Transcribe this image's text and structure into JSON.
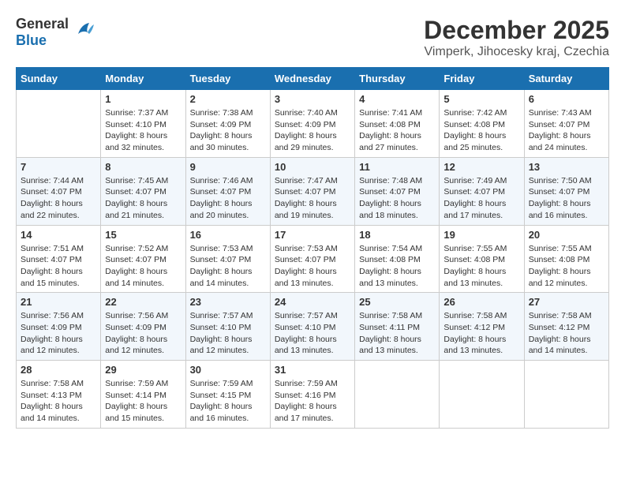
{
  "logo": {
    "general": "General",
    "blue": "Blue"
  },
  "title": "December 2025",
  "subtitle": "Vimperk, Jihocesky kraj, Czechia",
  "days_header": [
    "Sunday",
    "Monday",
    "Tuesday",
    "Wednesday",
    "Thursday",
    "Friday",
    "Saturday"
  ],
  "weeks": [
    [
      {
        "day": "",
        "sunrise": "",
        "sunset": "",
        "daylight": ""
      },
      {
        "day": "1",
        "sunrise": "Sunrise: 7:37 AM",
        "sunset": "Sunset: 4:10 PM",
        "daylight": "Daylight: 8 hours and 32 minutes."
      },
      {
        "day": "2",
        "sunrise": "Sunrise: 7:38 AM",
        "sunset": "Sunset: 4:09 PM",
        "daylight": "Daylight: 8 hours and 30 minutes."
      },
      {
        "day": "3",
        "sunrise": "Sunrise: 7:40 AM",
        "sunset": "Sunset: 4:09 PM",
        "daylight": "Daylight: 8 hours and 29 minutes."
      },
      {
        "day": "4",
        "sunrise": "Sunrise: 7:41 AM",
        "sunset": "Sunset: 4:08 PM",
        "daylight": "Daylight: 8 hours and 27 minutes."
      },
      {
        "day": "5",
        "sunrise": "Sunrise: 7:42 AM",
        "sunset": "Sunset: 4:08 PM",
        "daylight": "Daylight: 8 hours and 25 minutes."
      },
      {
        "day": "6",
        "sunrise": "Sunrise: 7:43 AM",
        "sunset": "Sunset: 4:07 PM",
        "daylight": "Daylight: 8 hours and 24 minutes."
      }
    ],
    [
      {
        "day": "7",
        "sunrise": "Sunrise: 7:44 AM",
        "sunset": "Sunset: 4:07 PM",
        "daylight": "Daylight: 8 hours and 22 minutes."
      },
      {
        "day": "8",
        "sunrise": "Sunrise: 7:45 AM",
        "sunset": "Sunset: 4:07 PM",
        "daylight": "Daylight: 8 hours and 21 minutes."
      },
      {
        "day": "9",
        "sunrise": "Sunrise: 7:46 AM",
        "sunset": "Sunset: 4:07 PM",
        "daylight": "Daylight: 8 hours and 20 minutes."
      },
      {
        "day": "10",
        "sunrise": "Sunrise: 7:47 AM",
        "sunset": "Sunset: 4:07 PM",
        "daylight": "Daylight: 8 hours and 19 minutes."
      },
      {
        "day": "11",
        "sunrise": "Sunrise: 7:48 AM",
        "sunset": "Sunset: 4:07 PM",
        "daylight": "Daylight: 8 hours and 18 minutes."
      },
      {
        "day": "12",
        "sunrise": "Sunrise: 7:49 AM",
        "sunset": "Sunset: 4:07 PM",
        "daylight": "Daylight: 8 hours and 17 minutes."
      },
      {
        "day": "13",
        "sunrise": "Sunrise: 7:50 AM",
        "sunset": "Sunset: 4:07 PM",
        "daylight": "Daylight: 8 hours and 16 minutes."
      }
    ],
    [
      {
        "day": "14",
        "sunrise": "Sunrise: 7:51 AM",
        "sunset": "Sunset: 4:07 PM",
        "daylight": "Daylight: 8 hours and 15 minutes."
      },
      {
        "day": "15",
        "sunrise": "Sunrise: 7:52 AM",
        "sunset": "Sunset: 4:07 PM",
        "daylight": "Daylight: 8 hours and 14 minutes."
      },
      {
        "day": "16",
        "sunrise": "Sunrise: 7:53 AM",
        "sunset": "Sunset: 4:07 PM",
        "daylight": "Daylight: 8 hours and 14 minutes."
      },
      {
        "day": "17",
        "sunrise": "Sunrise: 7:53 AM",
        "sunset": "Sunset: 4:07 PM",
        "daylight": "Daylight: 8 hours and 13 minutes."
      },
      {
        "day": "18",
        "sunrise": "Sunrise: 7:54 AM",
        "sunset": "Sunset: 4:08 PM",
        "daylight": "Daylight: 8 hours and 13 minutes."
      },
      {
        "day": "19",
        "sunrise": "Sunrise: 7:55 AM",
        "sunset": "Sunset: 4:08 PM",
        "daylight": "Daylight: 8 hours and 13 minutes."
      },
      {
        "day": "20",
        "sunrise": "Sunrise: 7:55 AM",
        "sunset": "Sunset: 4:08 PM",
        "daylight": "Daylight: 8 hours and 12 minutes."
      }
    ],
    [
      {
        "day": "21",
        "sunrise": "Sunrise: 7:56 AM",
        "sunset": "Sunset: 4:09 PM",
        "daylight": "Daylight: 8 hours and 12 minutes."
      },
      {
        "day": "22",
        "sunrise": "Sunrise: 7:56 AM",
        "sunset": "Sunset: 4:09 PM",
        "daylight": "Daylight: 8 hours and 12 minutes."
      },
      {
        "day": "23",
        "sunrise": "Sunrise: 7:57 AM",
        "sunset": "Sunset: 4:10 PM",
        "daylight": "Daylight: 8 hours and 12 minutes."
      },
      {
        "day": "24",
        "sunrise": "Sunrise: 7:57 AM",
        "sunset": "Sunset: 4:10 PM",
        "daylight": "Daylight: 8 hours and 13 minutes."
      },
      {
        "day": "25",
        "sunrise": "Sunrise: 7:58 AM",
        "sunset": "Sunset: 4:11 PM",
        "daylight": "Daylight: 8 hours and 13 minutes."
      },
      {
        "day": "26",
        "sunrise": "Sunrise: 7:58 AM",
        "sunset": "Sunset: 4:12 PM",
        "daylight": "Daylight: 8 hours and 13 minutes."
      },
      {
        "day": "27",
        "sunrise": "Sunrise: 7:58 AM",
        "sunset": "Sunset: 4:12 PM",
        "daylight": "Daylight: 8 hours and 14 minutes."
      }
    ],
    [
      {
        "day": "28",
        "sunrise": "Sunrise: 7:58 AM",
        "sunset": "Sunset: 4:13 PM",
        "daylight": "Daylight: 8 hours and 14 minutes."
      },
      {
        "day": "29",
        "sunrise": "Sunrise: 7:59 AM",
        "sunset": "Sunset: 4:14 PM",
        "daylight": "Daylight: 8 hours and 15 minutes."
      },
      {
        "day": "30",
        "sunrise": "Sunrise: 7:59 AM",
        "sunset": "Sunset: 4:15 PM",
        "daylight": "Daylight: 8 hours and 16 minutes."
      },
      {
        "day": "31",
        "sunrise": "Sunrise: 7:59 AM",
        "sunset": "Sunset: 4:16 PM",
        "daylight": "Daylight: 8 hours and 17 minutes."
      },
      {
        "day": "",
        "sunrise": "",
        "sunset": "",
        "daylight": ""
      },
      {
        "day": "",
        "sunrise": "",
        "sunset": "",
        "daylight": ""
      },
      {
        "day": "",
        "sunrise": "",
        "sunset": "",
        "daylight": ""
      }
    ]
  ]
}
